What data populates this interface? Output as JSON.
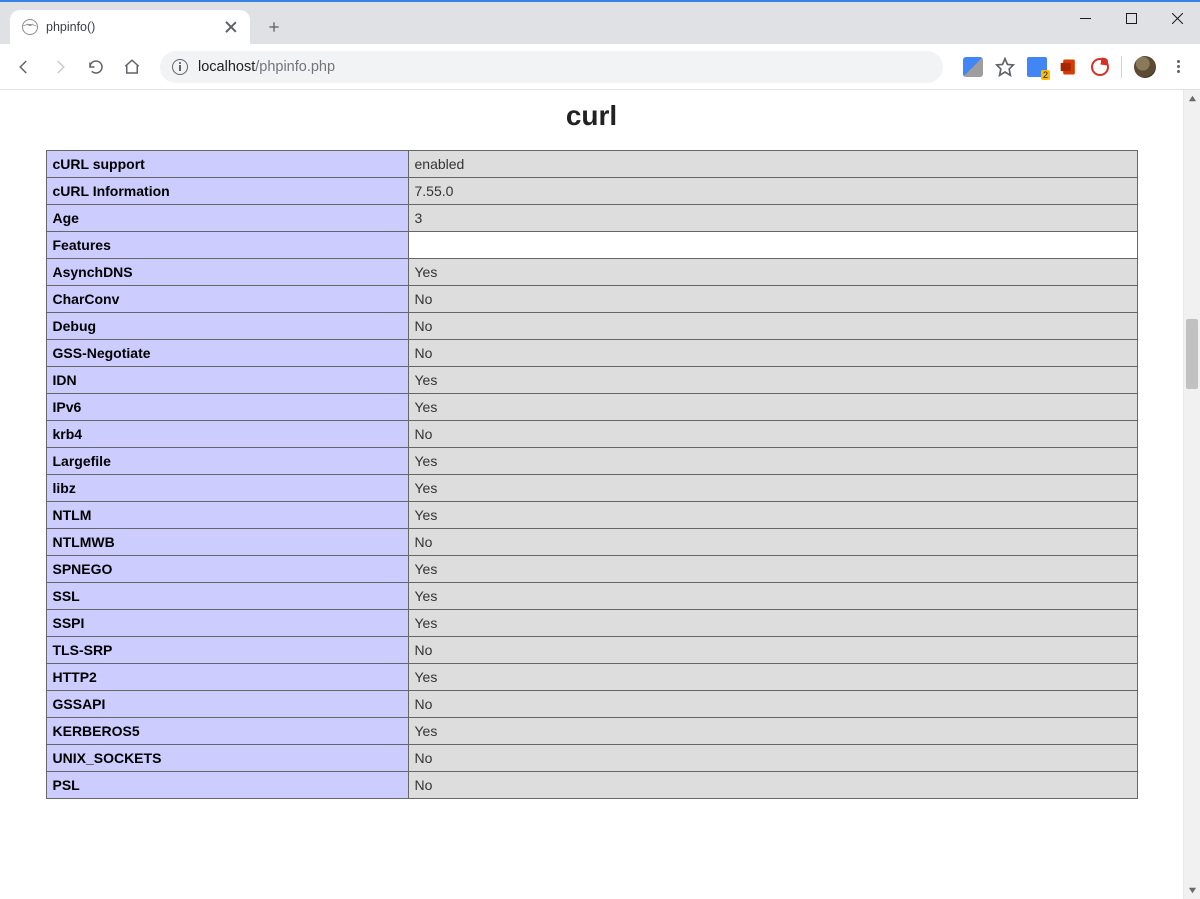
{
  "window": {
    "minimize": "–",
    "maximize": "□",
    "close": "×"
  },
  "tab": {
    "title": "phpinfo()"
  },
  "toolbar": {
    "url_host": "localhost",
    "url_path": "/phpinfo.php",
    "translate_badge": "2"
  },
  "page": {
    "module_title": "curl",
    "rows": [
      {
        "key": "cURL support",
        "value": "enabled",
        "valueClass": "v"
      },
      {
        "key": "cURL Information",
        "value": "7.55.0",
        "valueClass": "v"
      },
      {
        "key": "Age",
        "value": "3",
        "valueClass": "v"
      },
      {
        "key": "Features",
        "value": "",
        "valueClass": "h"
      },
      {
        "key": "AsynchDNS",
        "value": "Yes",
        "valueClass": "v"
      },
      {
        "key": "CharConv",
        "value": "No",
        "valueClass": "v"
      },
      {
        "key": "Debug",
        "value": "No",
        "valueClass": "v"
      },
      {
        "key": "GSS-Negotiate",
        "value": "No",
        "valueClass": "v"
      },
      {
        "key": "IDN",
        "value": "Yes",
        "valueClass": "v"
      },
      {
        "key": "IPv6",
        "value": "Yes",
        "valueClass": "v"
      },
      {
        "key": "krb4",
        "value": "No",
        "valueClass": "v"
      },
      {
        "key": "Largefile",
        "value": "Yes",
        "valueClass": "v"
      },
      {
        "key": "libz",
        "value": "Yes",
        "valueClass": "v"
      },
      {
        "key": "NTLM",
        "value": "Yes",
        "valueClass": "v"
      },
      {
        "key": "NTLMWB",
        "value": "No",
        "valueClass": "v"
      },
      {
        "key": "SPNEGO",
        "value": "Yes",
        "valueClass": "v"
      },
      {
        "key": "SSL",
        "value": "Yes",
        "valueClass": "v"
      },
      {
        "key": "SSPI",
        "value": "Yes",
        "valueClass": "v"
      },
      {
        "key": "TLS-SRP",
        "value": "No",
        "valueClass": "v"
      },
      {
        "key": "HTTP2",
        "value": "Yes",
        "valueClass": "v"
      },
      {
        "key": "GSSAPI",
        "value": "No",
        "valueClass": "v"
      },
      {
        "key": "KERBEROS5",
        "value": "Yes",
        "valueClass": "v"
      },
      {
        "key": "UNIX_SOCKETS",
        "value": "No",
        "valueClass": "v"
      },
      {
        "key": "PSL",
        "value": "No",
        "valueClass": "v"
      }
    ]
  }
}
